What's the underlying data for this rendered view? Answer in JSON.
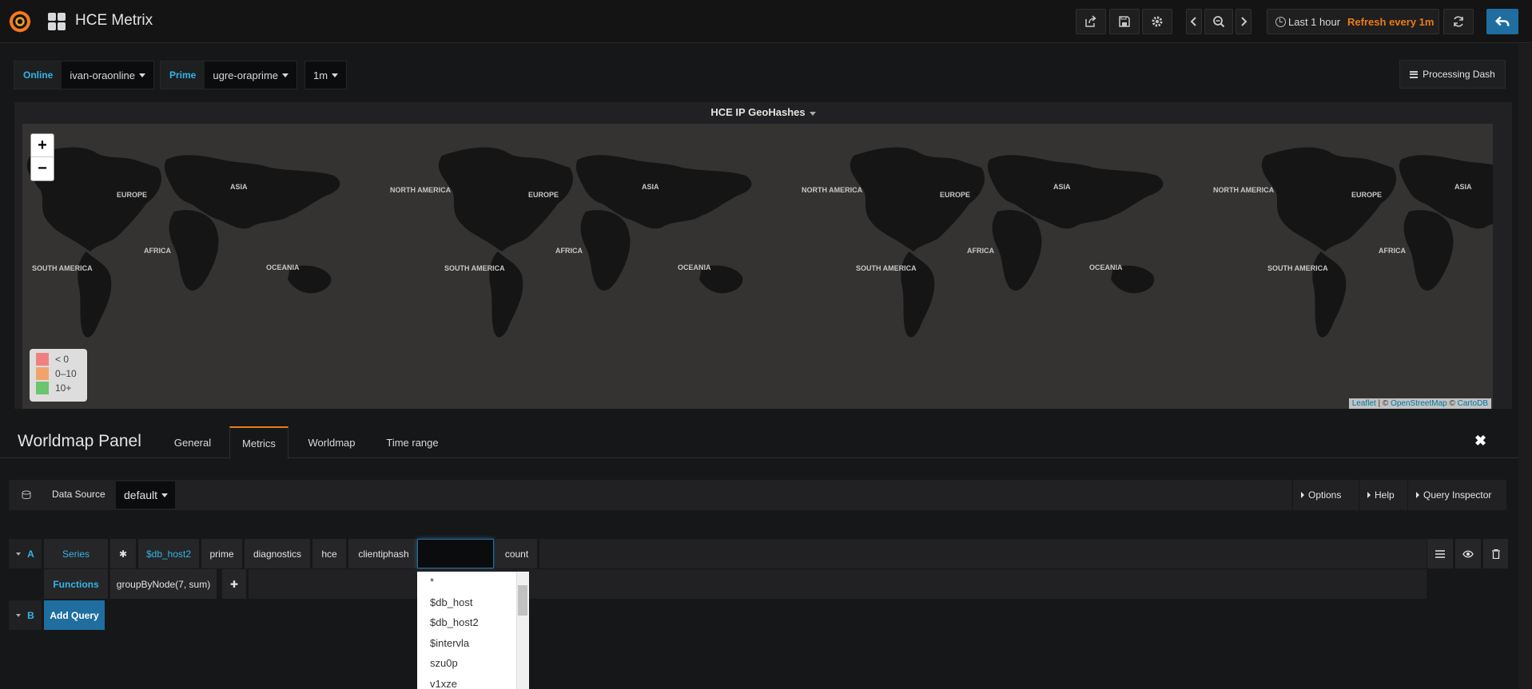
{
  "app": {
    "title": "HCE Metrix"
  },
  "toolbar": {
    "time_range": "Last 1 hour",
    "refresh": "Refresh every 1m"
  },
  "variables": [
    {
      "label": "Online",
      "value": "ivan-oraonline"
    },
    {
      "label": "Prime",
      "value": "ugre-oraprime"
    },
    {
      "label": "",
      "value": "1m"
    }
  ],
  "processing_button": "Processing Dash",
  "panel": {
    "title": "HCE IP GeoHashes",
    "zoom_in": "+",
    "zoom_out": "−",
    "legend": [
      {
        "label": "< 0",
        "color": "#f0807f"
      },
      {
        "label": "0–10",
        "color": "#f2a36c"
      },
      {
        "label": "10+",
        "color": "#6bc46e"
      }
    ],
    "attribution": {
      "leaflet": "Leaflet",
      "sep1": " | © ",
      "osm": "OpenStreetMap",
      "sep2": " © ",
      "carto": "CartoDB"
    },
    "map_labels": [
      "EUROPE",
      "ASIA",
      "AFRICA",
      "OCEANIA",
      "NORTH AMERICA",
      "SOUTH AMERICA"
    ]
  },
  "editor": {
    "title": "Worldmap Panel",
    "tabs": [
      "General",
      "Metrics",
      "Worldmap",
      "Time range"
    ],
    "active_tab": "Metrics"
  },
  "datasource": {
    "label": "Data Source",
    "value": "default",
    "options": "Options",
    "help": "Help",
    "inspector": "Query Inspector"
  },
  "query_a": {
    "ref": "A",
    "series_label": "Series",
    "segments": [
      "✱",
      "$db_host2",
      "prime",
      "diagnostics",
      "hce",
      "clientiphash",
      "",
      "count"
    ],
    "functions_label": "Functions",
    "function": "groupByNode(7, sum)",
    "add_fn": "✚"
  },
  "query_b": {
    "ref": "B",
    "add_query": "Add Query"
  },
  "dropdown": {
    "items": [
      "*",
      "$db_host",
      "$db_host2",
      "$intervla",
      "szu0p",
      "v1xze"
    ]
  },
  "colors": {
    "accent": "#33b5e5",
    "orange": "#eb7b18",
    "primary": "#1f6e9f"
  }
}
